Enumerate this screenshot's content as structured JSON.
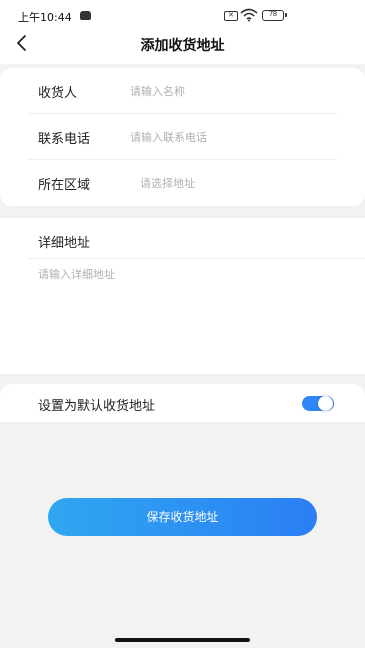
{
  "status_bar": {
    "time": "上午10:44",
    "battery": "78",
    "icons": [
      "app-notification-icon",
      "sim-icon",
      "wifi-icon",
      "battery-icon"
    ]
  },
  "nav": {
    "title": "添加收货地址",
    "back_icon": "chevron-left-icon"
  },
  "form": {
    "receiver": {
      "label": "收货人",
      "placeholder": "请输入名称",
      "value": ""
    },
    "phone": {
      "label": "联系电话",
      "placeholder": "请输入联系电话",
      "value": ""
    },
    "region": {
      "label": "所在区域",
      "placeholder": "请选择地址",
      "value": ""
    }
  },
  "detail": {
    "label": "详细地址",
    "placeholder": "请输入详细地址",
    "value": ""
  },
  "default_address": {
    "label": "设置为默认收货地址",
    "enabled": true
  },
  "save_button": {
    "label": "保存收货地址"
  },
  "colors": {
    "accent": "#2b7ef4",
    "background": "#f2f2f2",
    "placeholder": "#b0b0b0"
  }
}
